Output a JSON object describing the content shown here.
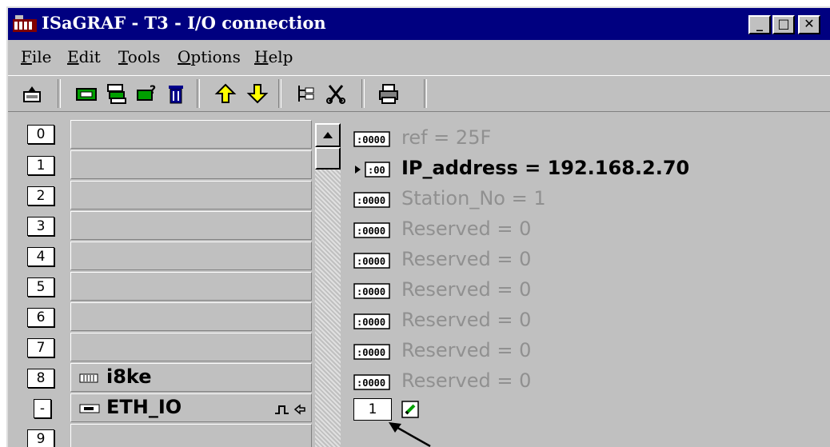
{
  "window": {
    "title": "ISaGRAF - T3 - I/O connection",
    "controls": {
      "minimize": "_",
      "maximize": "□",
      "close": "✕"
    }
  },
  "menu": [
    {
      "label": "File",
      "ul": "F",
      "rest": "ile"
    },
    {
      "label": "Edit",
      "ul": "E",
      "rest": "dit"
    },
    {
      "label": "Tools",
      "ul": "T",
      "rest": "ools"
    },
    {
      "label": "Options",
      "ul": "O",
      "rest": "ptions"
    },
    {
      "label": "Help",
      "ul": "H",
      "rest": "elp"
    }
  ],
  "toolbar": [
    "open-board-icon",
    "set-board-icon",
    "board-params-icon",
    "virtual-board-icon",
    "delete-icon",
    "move-up-icon",
    "move-down-icon",
    "tree-icon",
    "cut-icon",
    "print-icon"
  ],
  "slots": [
    {
      "num": "0",
      "label": ""
    },
    {
      "num": "1",
      "label": ""
    },
    {
      "num": "2",
      "label": ""
    },
    {
      "num": "3",
      "label": ""
    },
    {
      "num": "4",
      "label": ""
    },
    {
      "num": "5",
      "label": ""
    },
    {
      "num": "6",
      "label": ""
    },
    {
      "num": "7",
      "label": ""
    },
    {
      "num": "8",
      "label": "i8ke"
    },
    {
      "num": "-",
      "label": "ETH_IO"
    },
    {
      "num": "9",
      "label": ""
    }
  ],
  "params": [
    {
      "text": "ref = 25F",
      "active": false
    },
    {
      "text": "IP_address = 192.168.2.70",
      "active": true
    },
    {
      "text": "Station_No = 1",
      "active": false
    },
    {
      "text": "Reserved = 0",
      "active": false
    },
    {
      "text": "Reserved = 0",
      "active": false
    },
    {
      "text": "Reserved = 0",
      "active": false
    },
    {
      "text": "Reserved = 0",
      "active": false
    },
    {
      "text": "Reserved = 0",
      "active": false
    },
    {
      "text": "Reserved = 0",
      "active": false
    }
  ],
  "channel": {
    "value": "1"
  },
  "colors": {
    "titlebar": "#000080",
    "window": "#c0c0c0",
    "inactive_text": "#909090"
  }
}
